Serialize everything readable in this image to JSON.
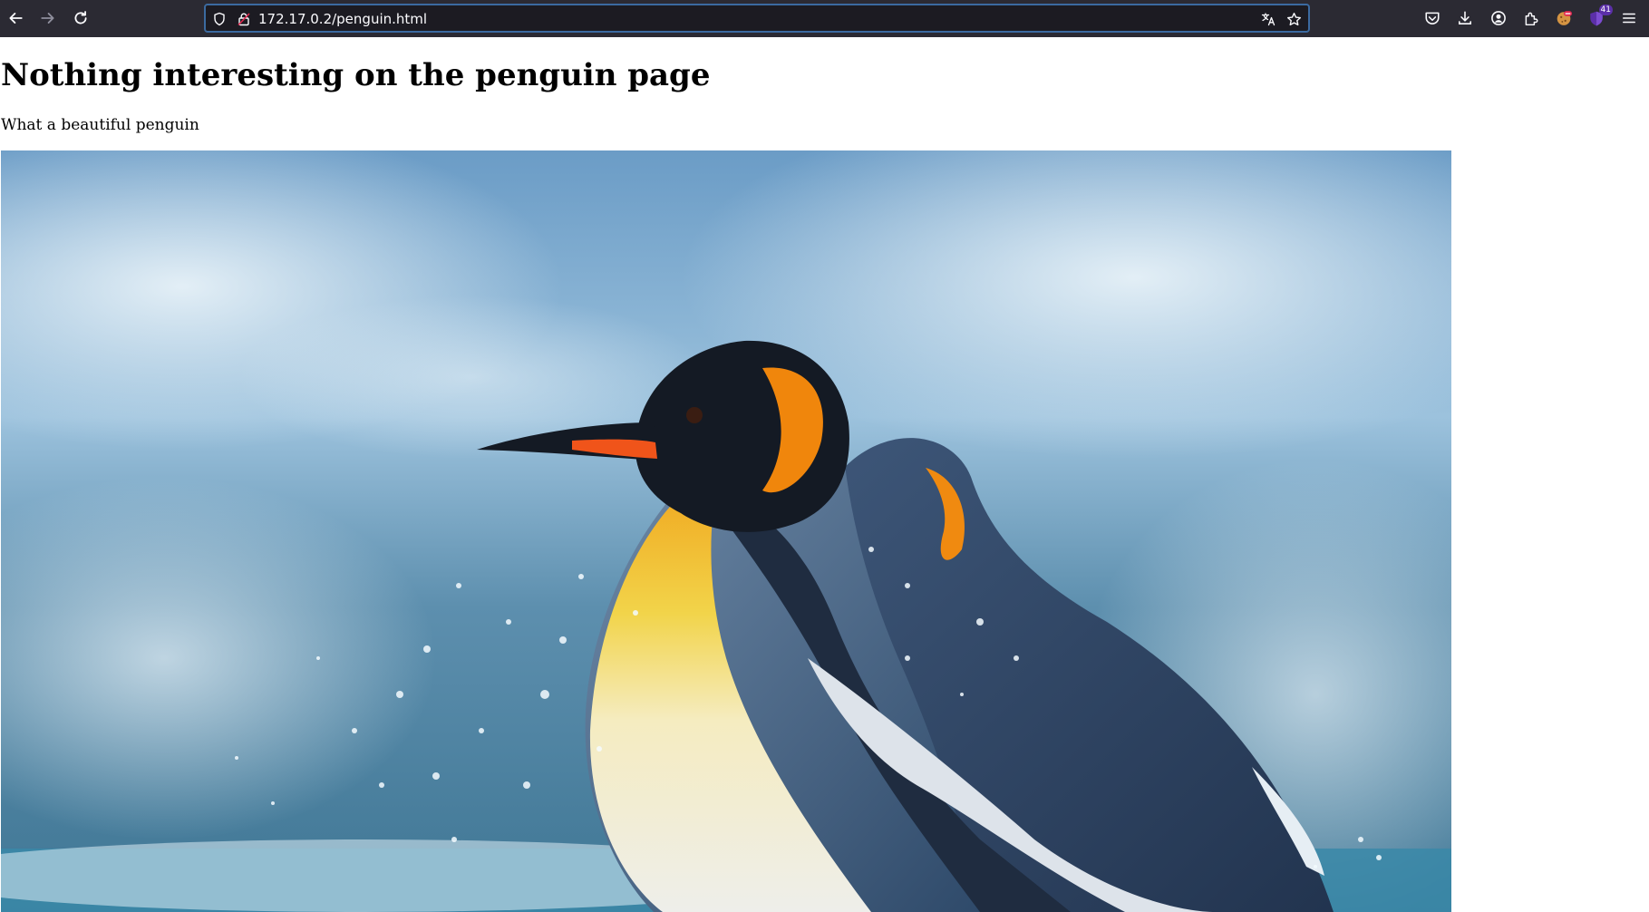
{
  "browser": {
    "url": "172.17.0.2/penguin.html",
    "icons": {
      "back": "arrow-left-icon",
      "forward": "arrow-right-icon",
      "reload": "reload-icon",
      "tracking": "shield-icon",
      "security": "lock-icon",
      "translate": "translate-icon",
      "bookmark": "star-icon",
      "pocket": "pocket-icon",
      "downloads": "download-icon",
      "account": "account-icon",
      "extensions": "extensions-icon",
      "cookie_extension": "cookie-extension-icon",
      "ublock_extension": "ublock-extension-icon",
      "menu": "hamburger-menu-icon"
    },
    "ublock_badge": "41",
    "colors": {
      "toolbar_bg": "#2b2a33",
      "urlbar_bg": "#1c1b22",
      "urlbar_focus": "#3b6aa0"
    }
  },
  "page": {
    "title": "Nothing interesting on the penguin page",
    "subtitle": "What a beautiful penguin",
    "image": {
      "subject": "king-penguins-photo"
    }
  }
}
